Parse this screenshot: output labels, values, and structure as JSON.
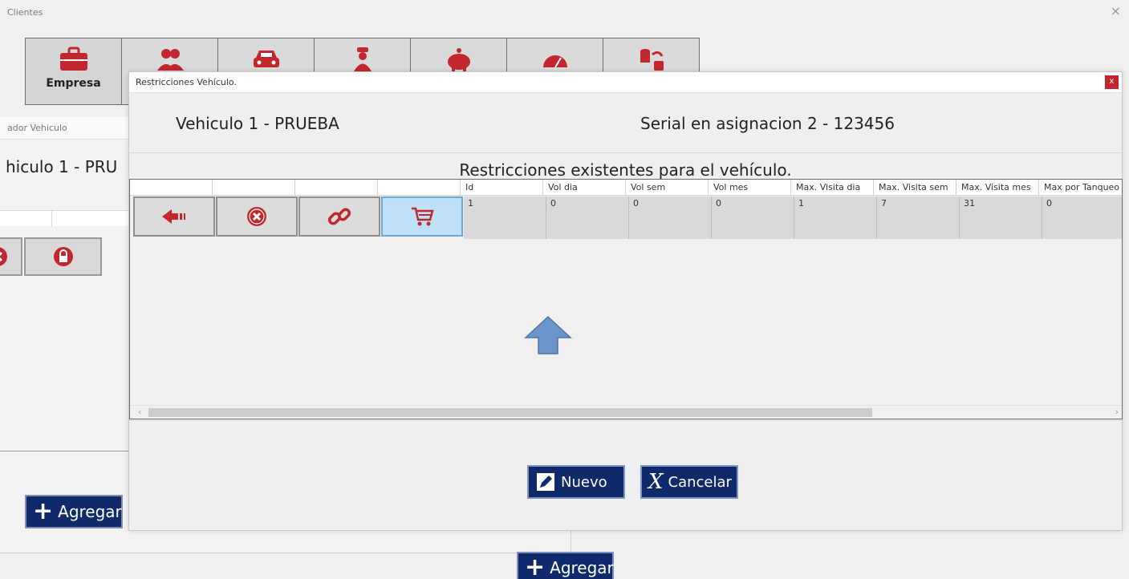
{
  "main": {
    "title": "Clientes",
    "close": "×",
    "toolbar": [
      {
        "label": "Empresa",
        "icon": "briefcase-icon"
      },
      {
        "label": "",
        "icon": "users-icon"
      },
      {
        "label": "",
        "icon": "car-icon"
      },
      {
        "label": "",
        "icon": "driver-icon"
      },
      {
        "label": "",
        "icon": "piggy-bank-icon"
      },
      {
        "label": "",
        "icon": "gauge-icon"
      },
      {
        "label": "",
        "icon": "fuel-transfer-icon"
      }
    ],
    "agregar_label": "Agregar"
  },
  "win2": {
    "title": "ador Vehiculo",
    "vehiculo": "hiculo   1 - PRU",
    "agregar_label": "Agregar"
  },
  "dialog": {
    "title": "Restricciones Vehículo.",
    "close": "x",
    "vehiculo": "Vehiculo    1 - PRUEBA",
    "serial": "Serial en asignacion   2 - 123456",
    "section_title": "Restricciones existentes para el vehículo.",
    "columns": [
      "",
      "",
      "",
      "",
      "Id",
      "Vol dia",
      "Vol sem",
      "Vol mes",
      "Max. Visita dia",
      "Max. Visita sem",
      "Max. Visita mes",
      "Max por Tanqueo"
    ],
    "row": [
      "1",
      "0",
      "0",
      "0",
      "1",
      "7",
      "31",
      "0"
    ],
    "actions": [
      "back-arrow-icon",
      "delete-icon",
      "link-icon",
      "cart-icon"
    ],
    "nuevo_label": "Nuevo",
    "cancelar_label": "Cancelar"
  },
  "colors": {
    "accent_red": "#c1272d",
    "navy": "#0e2a6a",
    "highlight": "#bfe0f9"
  }
}
